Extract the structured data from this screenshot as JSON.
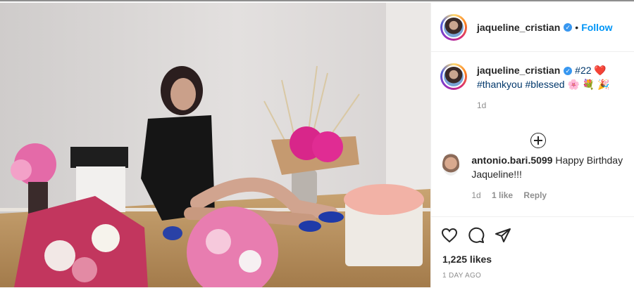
{
  "post_author": {
    "username": "jaqueline_cristian",
    "verified_badge": "✓",
    "follow_label": "Follow",
    "separator": "•"
  },
  "caption": {
    "username": "jaqueline_cristian",
    "tag_number": "#22",
    "tags_line2": "#thankyou #blessed",
    "emoji_heart": "❤️",
    "emoji_line2": "🌸 💐 🎉",
    "time": "1d"
  },
  "comment": {
    "username": "antonio.bari.5099",
    "text": "Happy Birthday Jaqueline!!!",
    "time": "1d",
    "likes": "1 like",
    "reply_label": "Reply"
  },
  "stats": {
    "likes": "1,225 likes",
    "posted": "1 DAY AGO"
  },
  "icons": [
    "heart-icon",
    "comment-icon",
    "share-icon",
    "load-more-icon"
  ],
  "colors": {
    "link": "#0095f6",
    "verified": "#3897f0"
  }
}
